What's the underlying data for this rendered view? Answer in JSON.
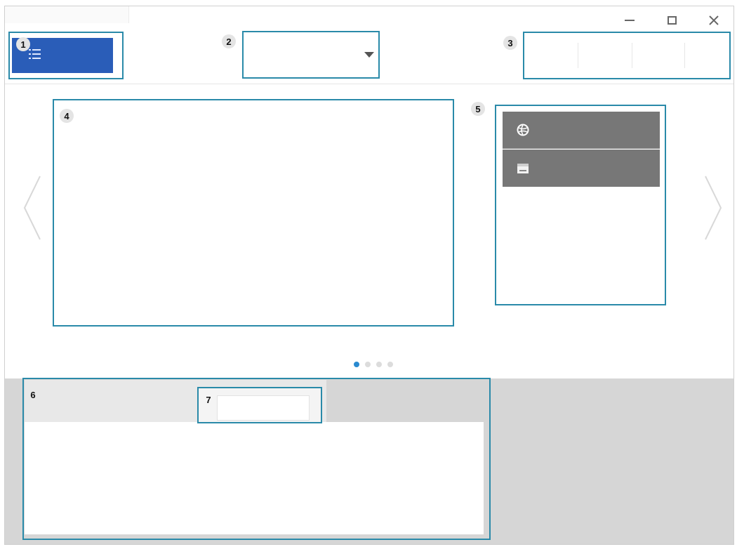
{
  "callouts": {
    "c1": "1",
    "c2": "2",
    "c3": "3",
    "c4": "4",
    "c5": "5",
    "c6": "6",
    "c7": "7"
  },
  "icons": {
    "menu": "list-menu-icon",
    "dropdown": "chevron-down-icon",
    "minimize": "minimize-icon",
    "maximize": "maximize-icon",
    "close": "close-icon",
    "left_arrow": "chevron-left-icon",
    "right_arrow": "chevron-right-icon",
    "mode1": "globe-icon",
    "mode2": "printer-icon"
  },
  "carousel": {
    "page_count": 4,
    "active_page": 1
  },
  "colors": {
    "accent": "#2a5db8",
    "callout_border": "#2a8aa9",
    "mode_panel": "#777777",
    "bottom_bar": "#e8e8e8",
    "bottom_side": "#d6d6d6"
  }
}
